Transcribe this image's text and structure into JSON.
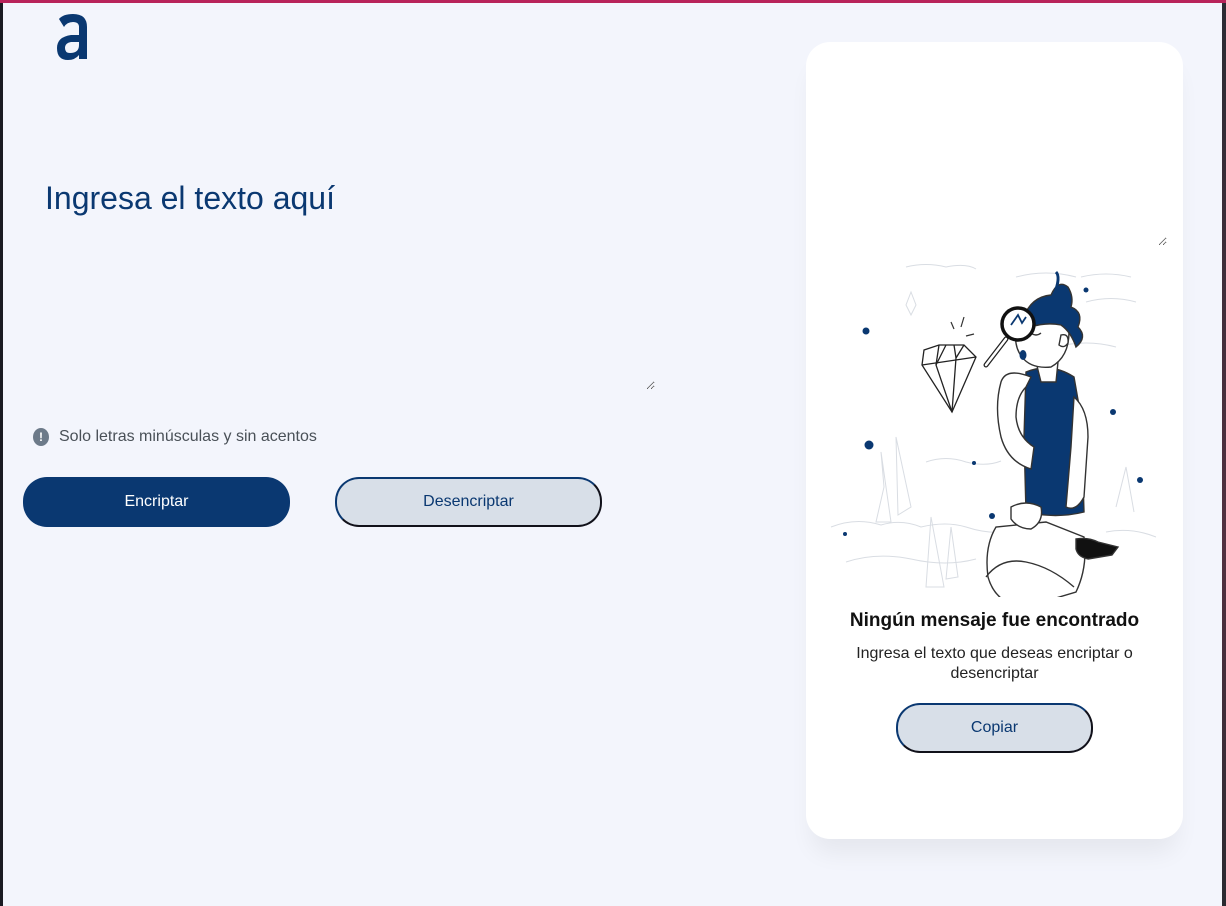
{
  "header": {
    "logo_icon": "alura-a-logo"
  },
  "input_panel": {
    "placeholder": "Ingresa el texto aquí",
    "hint_icon": "exclamation-circle-icon",
    "hint_text": "Solo letras minúsculas y sin acentos",
    "encrypt_label": "Encriptar",
    "decrypt_label": "Desencriptar"
  },
  "output_panel": {
    "output_value": "",
    "illustration": "person-with-magnifying-glass-illustration",
    "empty_title": "Ningún mensaje fue encontrado",
    "empty_text": "Ingresa el texto que deseas encriptar o desencriptar",
    "copy_label": "Copiar"
  },
  "colors": {
    "primary": "#0a3871",
    "background": "#f3f5fc",
    "card": "#ffffff",
    "secondary_button": "#d8dfe8",
    "top_accent": "#b8235a"
  }
}
